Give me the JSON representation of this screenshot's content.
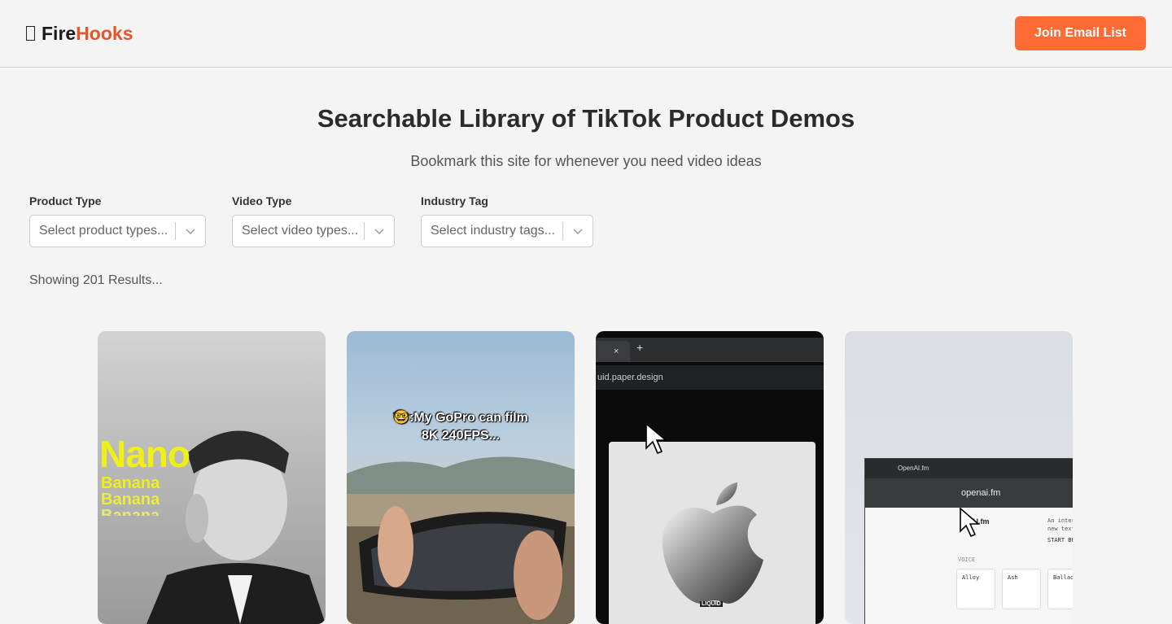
{
  "header": {
    "logo_main": "Fire",
    "logo_accent": "Hooks",
    "join_label": "Join Email List"
  },
  "hero": {
    "title": "Searchable Library of TikTok Product Demos",
    "subtitle": "Bookmark this site for whenever you need video ideas"
  },
  "filters": [
    {
      "label": "Product Type",
      "placeholder": "Select product types..."
    },
    {
      "label": "Video Type",
      "placeholder": "Select video types..."
    },
    {
      "label": "Industry Tag",
      "placeholder": "Select industry tags..."
    }
  ],
  "results_text": "Showing 201 Results...",
  "cards": [
    {
      "overlay": [
        "Nano",
        "Banana",
        "Banana",
        "Banana"
      ]
    },
    {
      "overlay": [
        "🤓:My GoPro can film",
        "8K 240FPS..."
      ]
    },
    {
      "tab_close": "×",
      "tab_add": "+",
      "address": "uid.paper.design",
      "tag": "LIQUID"
    },
    {
      "tab_title": "OpenAI.fm",
      "address": "openai.fm",
      "site_label": "AI.fm",
      "side_text_1": "An inter",
      "side_text_2": "new text",
      "side_text_3": "START BU",
      "voice_label": "VOICE",
      "voices": [
        "Alloy",
        "Ash",
        "Ballad"
      ]
    }
  ],
  "colors": {
    "accent": "#ff6b35",
    "logo_accent": "#e2562a",
    "background": "#f4f4f4"
  }
}
